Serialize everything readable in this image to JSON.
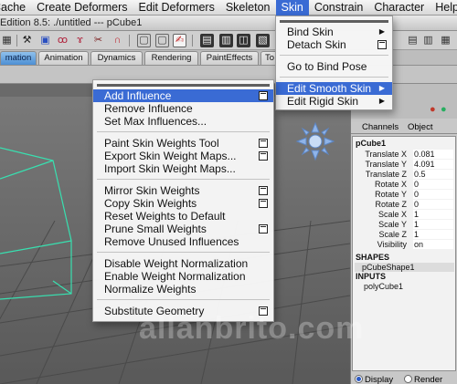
{
  "menubar": {
    "items": [
      "Cache",
      "Create Deformers",
      "Edit Deformers",
      "Skeleton",
      "Skin",
      "Constrain",
      "Character",
      "Help"
    ],
    "active_item": "Skin"
  },
  "titlebar": {
    "text": "Edition 8.5: ./untitled   ---   pCube1"
  },
  "shelf_tabs": [
    "mation",
    "Animation",
    "Dynamics",
    "Rendering",
    "PaintEffects",
    "To"
  ],
  "skin_menu": {
    "items": [
      {
        "label": "Bind Skin",
        "submenu": true
      },
      {
        "label": "Detach Skin",
        "option_box": true
      },
      {
        "label": "Go to Bind Pose"
      },
      {
        "label": "Edit Smooth Skin",
        "submenu": true,
        "highlighted": true
      },
      {
        "label": "Edit Rigid Skin",
        "submenu": true
      }
    ]
  },
  "smooth_skin_menu": {
    "items": [
      {
        "label": "Add Influence",
        "option_box": true,
        "highlighted": true
      },
      {
        "label": "Remove Influence"
      },
      {
        "label": "Set Max Influences..."
      },
      {
        "label": "Paint Skin Weights Tool",
        "option_box": true
      },
      {
        "label": "Export Skin Weight Maps...",
        "option_box": true
      },
      {
        "label": "Import Skin Weight Maps..."
      },
      {
        "label": "Mirror Skin Weights",
        "option_box": true
      },
      {
        "label": "Copy Skin Weights",
        "option_box": true
      },
      {
        "label": "Reset Weights to Default"
      },
      {
        "label": "Prune Small Weights",
        "option_box": true
      },
      {
        "label": "Remove Unused Influences"
      },
      {
        "label": "Disable Weight Normalization"
      },
      {
        "label": "Enable Weight Normalization"
      },
      {
        "label": "Normalize Weights"
      },
      {
        "label": "Substitute Geometry",
        "option_box": true
      }
    ]
  },
  "channel_box": {
    "tabs": [
      "Channels",
      "Object"
    ],
    "object_name": "pCube1",
    "attributes": [
      {
        "label": "Translate X",
        "value": "0.081"
      },
      {
        "label": "Translate Y",
        "value": "4.091"
      },
      {
        "label": "Translate Z",
        "value": "0.5"
      },
      {
        "label": "Rotate X",
        "value": "0"
      },
      {
        "label": "Rotate Y",
        "value": "0"
      },
      {
        "label": "Rotate Z",
        "value": "0"
      },
      {
        "label": "Scale X",
        "value": "1"
      },
      {
        "label": "Scale Y",
        "value": "1"
      },
      {
        "label": "Scale Z",
        "value": "1"
      },
      {
        "label": "Visibility",
        "value": "on"
      }
    ],
    "shapes_header": "SHAPES",
    "shape_name": "pCubeShape1",
    "inputs_header": "INPUTS",
    "input_name": "polyCube1",
    "display_label": "Display",
    "render_label": "Render"
  },
  "watermark": "allanbrito.com",
  "colors": {
    "menu_highlight": "#3a6bd4",
    "wireframe": "#38e0b0",
    "active_tab": "#4d8fd4"
  }
}
